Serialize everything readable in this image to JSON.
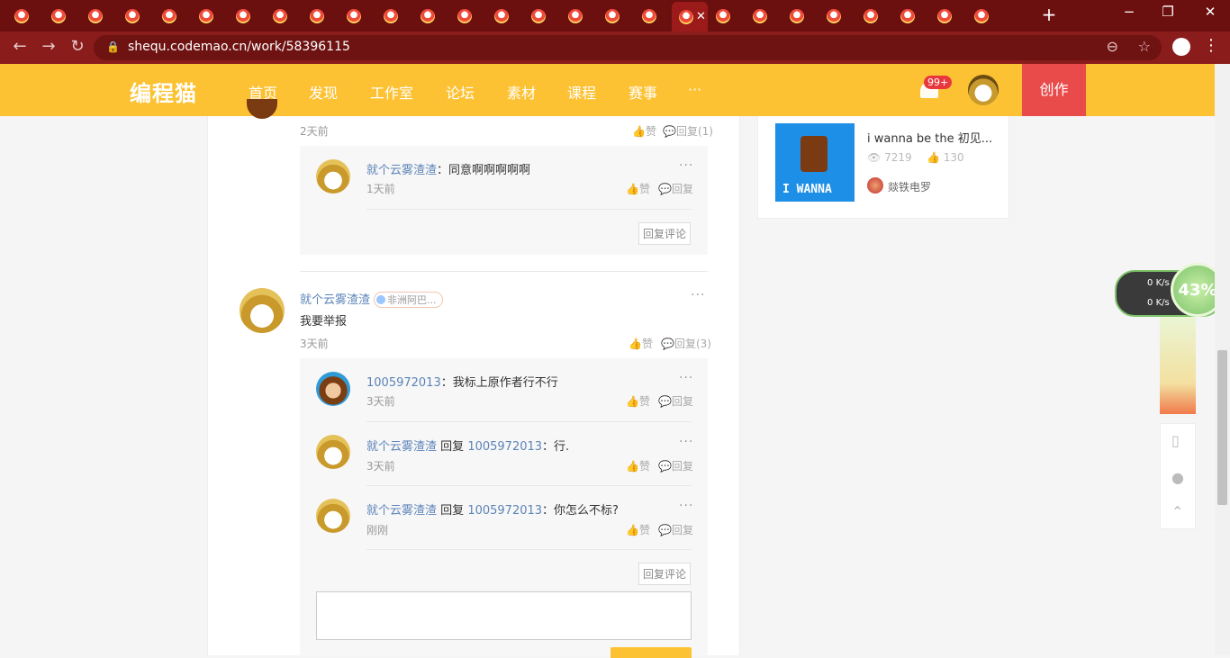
{
  "browser": {
    "tab_count": 27,
    "active_tab_index": 18,
    "url": "shequ.codemao.cn/work/58396115",
    "new_tab": "+",
    "win_min": "−",
    "win_max": "❐",
    "win_close": "✕"
  },
  "header": {
    "logo": "编程猫",
    "nav": [
      "首页",
      "发现",
      "工作室",
      "论坛",
      "素材",
      "课程",
      "赛事",
      "···"
    ],
    "notifications_badge": "99+",
    "create_label": "创作"
  },
  "top_comment": {
    "time": "2天前",
    "like_label": "赞",
    "reply_label": "回复(1)",
    "replies": [
      {
        "author": "就个云雾渣渣",
        "separator": "：",
        "text": "同意啊啊啊啊啊",
        "time": "1天前",
        "like_label": "赞",
        "reply_label": "回复"
      }
    ],
    "reply_comment_button": "回复评论"
  },
  "comment2": {
    "author": "就个云雾渣渣",
    "tag": "非洲阿巴...",
    "text": "我要举报",
    "time": "3天前",
    "like_label": "赞",
    "reply_label": "回复(3)",
    "replies": [
      {
        "author": "1005972013",
        "reply_to": "",
        "separator": "：",
        "text": "我标上原作者行不行",
        "time": "3天前",
        "like_label": "赞",
        "reply_label": "回复"
      },
      {
        "author": "就个云雾渣渣",
        "reply_word": "回复",
        "reply_to": "1005972013",
        "separator": "：",
        "text": "行.",
        "time": "3天前",
        "like_label": "赞",
        "reply_label": "回复"
      },
      {
        "author": "就个云雾渣渣",
        "reply_word": "回复",
        "reply_to": "1005972013",
        "separator": "：",
        "text": "你怎么不标?",
        "time": "刚刚",
        "like_label": "赞",
        "reply_label": "回复"
      }
    ],
    "reply_comment_button": "回复评论"
  },
  "sidebar_work": {
    "title": "i wanna be the 初见...",
    "cover_text": "I WANNA",
    "views": "7219",
    "likes": "130",
    "author": "燚铁电罗"
  },
  "speed_widget": {
    "up": "0",
    "down": "0",
    "unit": "K/s",
    "percent": "43%"
  }
}
